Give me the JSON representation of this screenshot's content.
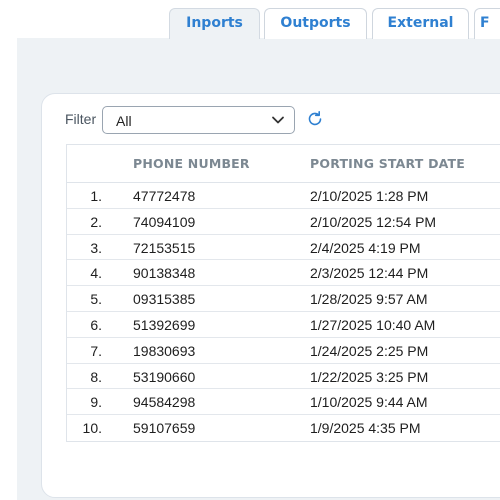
{
  "tabs": [
    {
      "label": "Inports",
      "active": true
    },
    {
      "label": "Outports",
      "active": false
    },
    {
      "label": "External",
      "active": false
    },
    {
      "label": "F",
      "active": false
    }
  ],
  "filter": {
    "label": "Filter",
    "selected": "All"
  },
  "colors": {
    "accent": "#2f80d1",
    "panel_bg": "#eef2f5"
  },
  "table": {
    "columns": [
      "",
      "PHONE NUMBER",
      "PORTING START DATE"
    ],
    "rows": [
      {
        "index": "1.",
        "phone": "47772478",
        "date": "2/10/2025 1:28 PM"
      },
      {
        "index": "2.",
        "phone": "74094109",
        "date": "2/10/2025 12:54 PM"
      },
      {
        "index": "3.",
        "phone": "72153515",
        "date": "2/4/2025 4:19 PM"
      },
      {
        "index": "4.",
        "phone": "90138348",
        "date": "2/3/2025 12:44 PM"
      },
      {
        "index": "5.",
        "phone": "09315385",
        "date": "1/28/2025 9:57 AM"
      },
      {
        "index": "6.",
        "phone": "51392699",
        "date": "1/27/2025 10:40 AM"
      },
      {
        "index": "7.",
        "phone": "19830693",
        "date": "1/24/2025 2:25 PM"
      },
      {
        "index": "8.",
        "phone": "53190660",
        "date": "1/22/2025 3:25 PM"
      },
      {
        "index": "9.",
        "phone": "94584298",
        "date": "1/10/2025 9:44 AM"
      },
      {
        "index": "10.",
        "phone": "59107659",
        "date": "1/9/2025 4:35 PM"
      }
    ]
  }
}
